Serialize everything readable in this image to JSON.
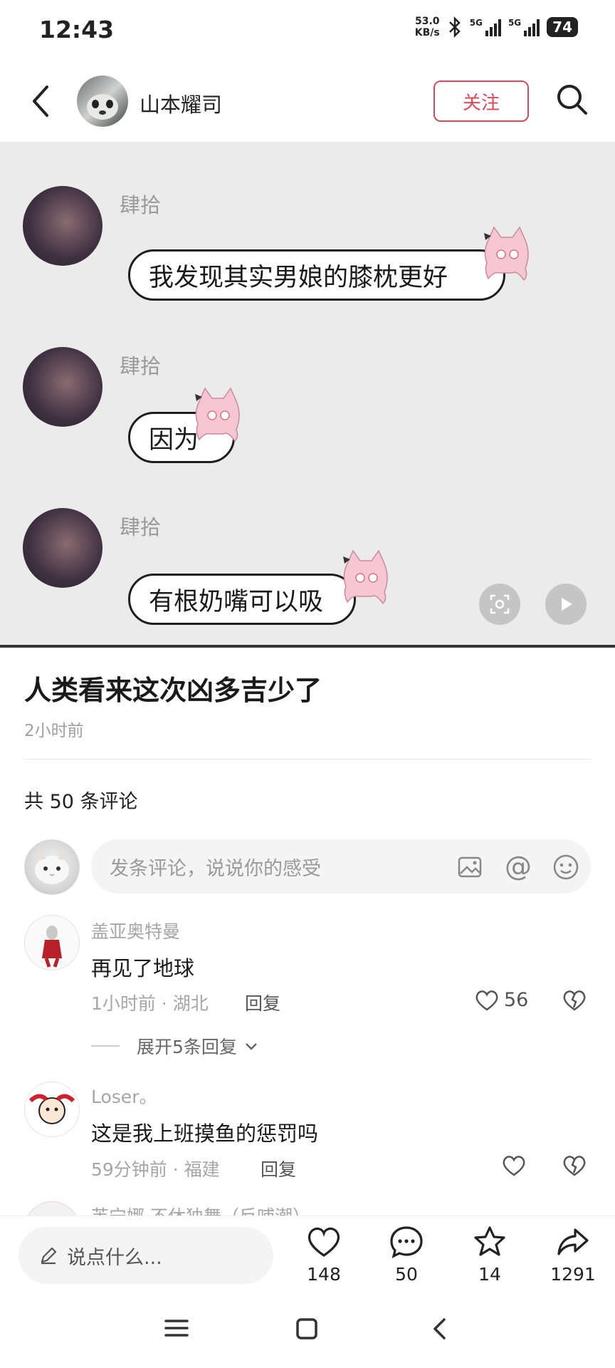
{
  "status_bar": {
    "time": "12:43",
    "net_speed_value": "53.0",
    "net_speed_unit": "KB/s",
    "signal1_label": "5G",
    "signal2_label": "5G",
    "battery": "74"
  },
  "header": {
    "author_name": "山本耀司",
    "follow_label": "关注"
  },
  "image": {
    "messages": [
      {
        "sender": "肆拾",
        "text": "我发现其实男娘的膝枕更好"
      },
      {
        "sender": "肆拾",
        "text": "因为"
      },
      {
        "sender": "肆拾",
        "text": "有根奶嘴可以吸"
      }
    ]
  },
  "post": {
    "title": "人类看来这次凶多吉少了",
    "time": "2小时前",
    "comment_total": "共 50 条评论"
  },
  "comment_input": {
    "placeholder": "发条评论，说说你的感受",
    "at_symbol": "@"
  },
  "comments": [
    {
      "user": "盖亚奥特曼",
      "text": "再见了地球",
      "meta": "1小时前 · 湖北",
      "reply_label": "回复",
      "likes": "56",
      "expand_label": "展开5条回复"
    },
    {
      "user": "Loser。",
      "text": "这是我上班摸鱼的惩罚吗",
      "meta": "59分钟前 · 福建",
      "reply_label": "回复"
    },
    {
      "user": "芙宁娜·不休独舞（反哺潮）"
    }
  ],
  "bottom_bar": {
    "say_placeholder": "说点什么...",
    "likes": "148",
    "comments": "50",
    "favorites": "14",
    "shares": "1291"
  },
  "colors": {
    "accent": "#d94a5b",
    "image_bg": "#ebebeb"
  }
}
